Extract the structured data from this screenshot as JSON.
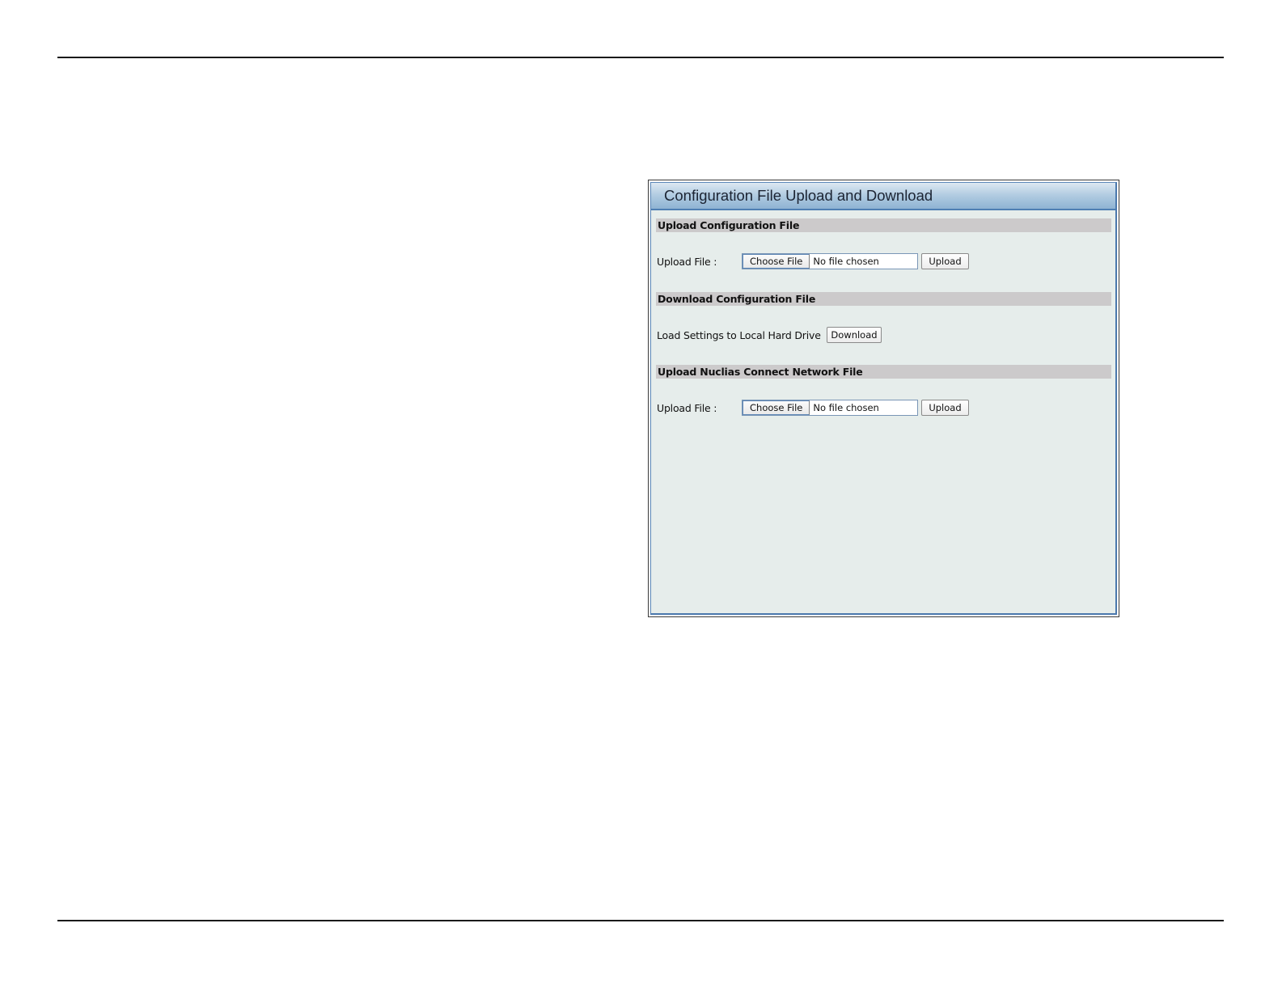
{
  "panel": {
    "title": "Configuration File Upload and Download"
  },
  "sections": {
    "upload_config": {
      "heading": "Upload Configuration File",
      "row_label": "Upload File :",
      "choose_label": "Choose File",
      "file_status": "No file chosen",
      "action_label": "Upload"
    },
    "download_config": {
      "heading": "Download Configuration File",
      "row_label": "Load Settings to Local Hard Drive",
      "action_label": "Download"
    },
    "upload_nuclias": {
      "heading": "Upload Nuclias Connect Network File",
      "row_label": "Upload File :",
      "choose_label": "Choose File",
      "file_status": "No file chosen",
      "action_label": "Upload"
    }
  }
}
